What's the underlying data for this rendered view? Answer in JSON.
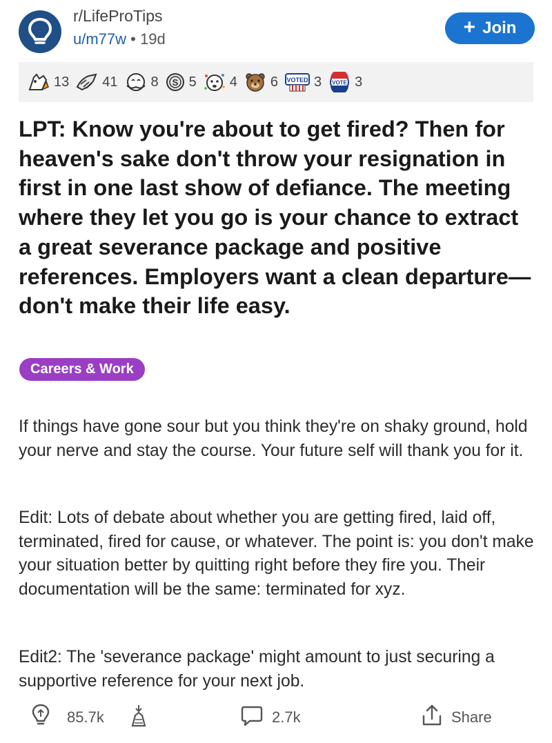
{
  "header": {
    "subreddit": "r/LifeProTips",
    "username": "u/m77w",
    "separator": "•",
    "age": "19d",
    "join_label": "Join",
    "join_plus": "+"
  },
  "awards": [
    {
      "icon": "wholesome-hands-icon",
      "count": "13"
    },
    {
      "icon": "helpful-hands-icon",
      "count": "41"
    },
    {
      "icon": "hug-face-icon",
      "count": "8"
    },
    {
      "icon": "silver-coin-icon",
      "count": "5"
    },
    {
      "icon": "party-face-icon",
      "count": "4"
    },
    {
      "icon": "bear-face-icon",
      "count": "6"
    },
    {
      "icon": "voted-sign-icon",
      "count": "3",
      "text": "VOTED"
    },
    {
      "icon": "vote-pin-icon",
      "count": "3",
      "text": "VOTE"
    }
  ],
  "post": {
    "title": "LPT: Know you're about to get fired? Then for heaven's sake don't throw your resignation in first in one last show of defiance. The meeting where they let you go is your chance to extract a great severance package and positive references. Employers want a clean departure—don't make their life easy.",
    "flair": "Careers & Work",
    "body": [
      "If things have gone sour but you think they're on shaky ground, hold your nerve and stay the course. Your future self will thank you for it.",
      "Edit: Lots of debate about whether you are getting fired, laid off, terminated, fired for cause, or whatever. The point is: you don't make your situation better by quitting right before they fire you. Their documentation will be the same: terminated for xyz.",
      "Edit2: The 'severance package' might amount to just securing a supportive reference for your next job."
    ]
  },
  "actions": {
    "upvotes": "85.7k",
    "comments": "2.7k",
    "share_label": "Share"
  },
  "colors": {
    "join_button": "#1b74d0",
    "flair_bg": "#9a3fc4",
    "subreddit_icon": "#1f4f86",
    "username": "#1f5fa8",
    "award_bar": "#f2f2f2"
  }
}
